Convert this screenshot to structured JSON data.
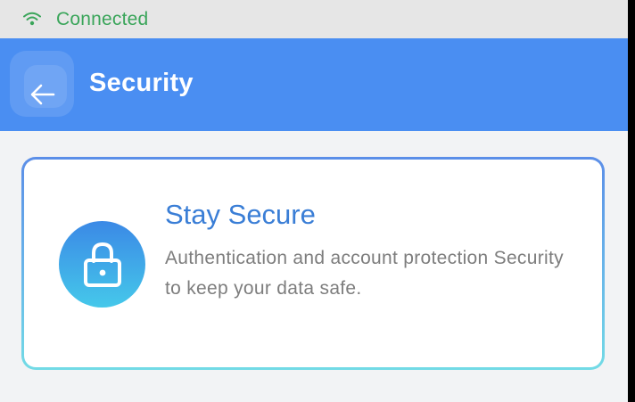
{
  "status_bar": {
    "icon": "wifi-icon",
    "text": "Connected",
    "color": "#3aa55a"
  },
  "header": {
    "back_icon": "arrow-left-icon",
    "title": "Security",
    "background": "#4a8ef2"
  },
  "card": {
    "icon": "lock-icon",
    "title": "Stay Secure",
    "description": "Authentication and account protection Security to keep your data safe.",
    "title_color": "#3a7ed6",
    "border_gradient": [
      "#5b8ee8",
      "#72dbe6"
    ]
  }
}
